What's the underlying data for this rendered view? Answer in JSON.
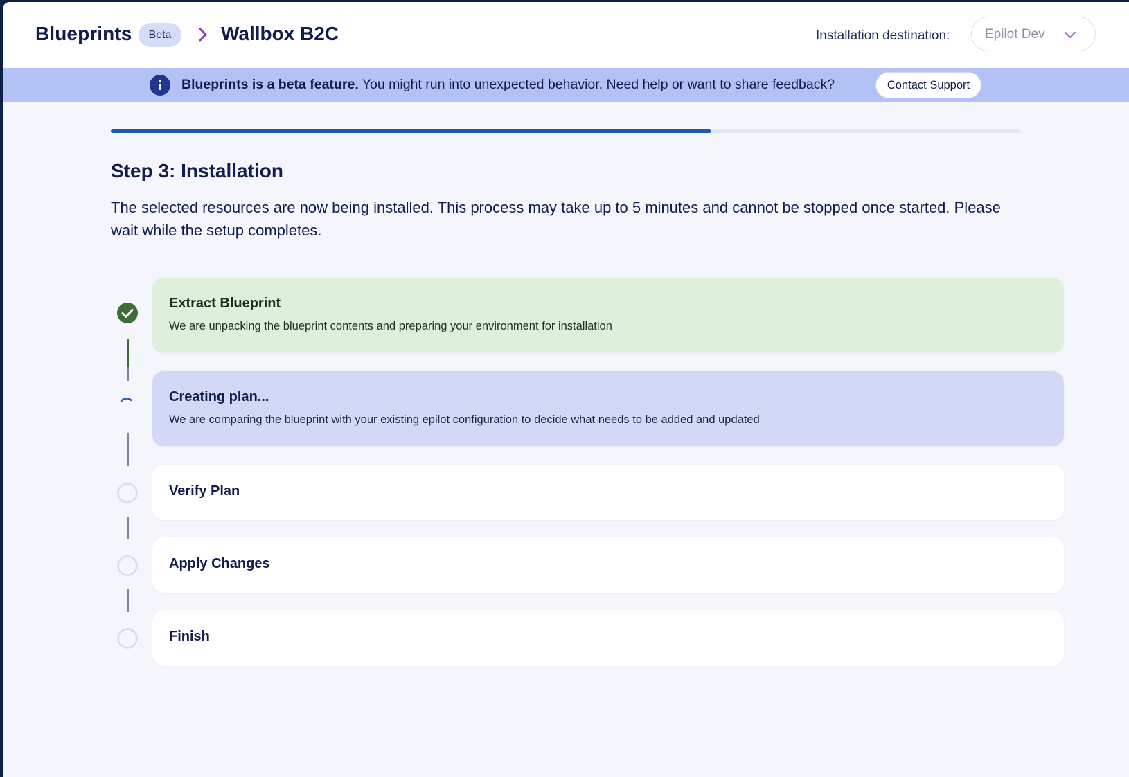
{
  "header": {
    "breadcrumb_root": "Blueprints",
    "beta_badge": "Beta",
    "breadcrumb_current": "Wallbox B2C",
    "destination_label": "Installation destination:",
    "destination_value": "Epilot Dev"
  },
  "banner": {
    "bold_text": "Blueprints is a beta feature.",
    "text": " You might run into unexpected behavior. Need help or want to share feedback?",
    "support_button": "Contact Support"
  },
  "progress": {
    "percent": 66
  },
  "step": {
    "title": "Step 3: Installation",
    "description": "The selected resources are now being installed. This process may take up to 5 minutes and cannot be stopped once started. Please wait while the setup completes."
  },
  "install_steps": [
    {
      "title": "Extract Blueprint",
      "description": "We are unpacking the blueprint contents and preparing your environment for installation",
      "state": "done"
    },
    {
      "title": "Creating plan...",
      "description": "We are comparing the blueprint with your existing epilot configuration to decide what needs to be added and updated",
      "state": "in-progress"
    },
    {
      "title": "Verify Plan",
      "description": "",
      "state": "pending"
    },
    {
      "title": "Apply Changes",
      "description": "",
      "state": "pending"
    },
    {
      "title": "Finish",
      "description": "",
      "state": "pending"
    }
  ],
  "colors": {
    "done_green": "#3e6d38",
    "active_blue": "#2c5fa8",
    "accent_purple": "#8e3aa8",
    "banner_bg": "#b3c1f5"
  },
  "icons": {
    "breadcrumb_separator": "chevron-right-icon",
    "dropdown": "chevron-down-icon",
    "banner": "info-icon",
    "step_done": "check-circle-icon",
    "step_active": "spinner-icon",
    "step_pending": "empty-circle-icon"
  }
}
